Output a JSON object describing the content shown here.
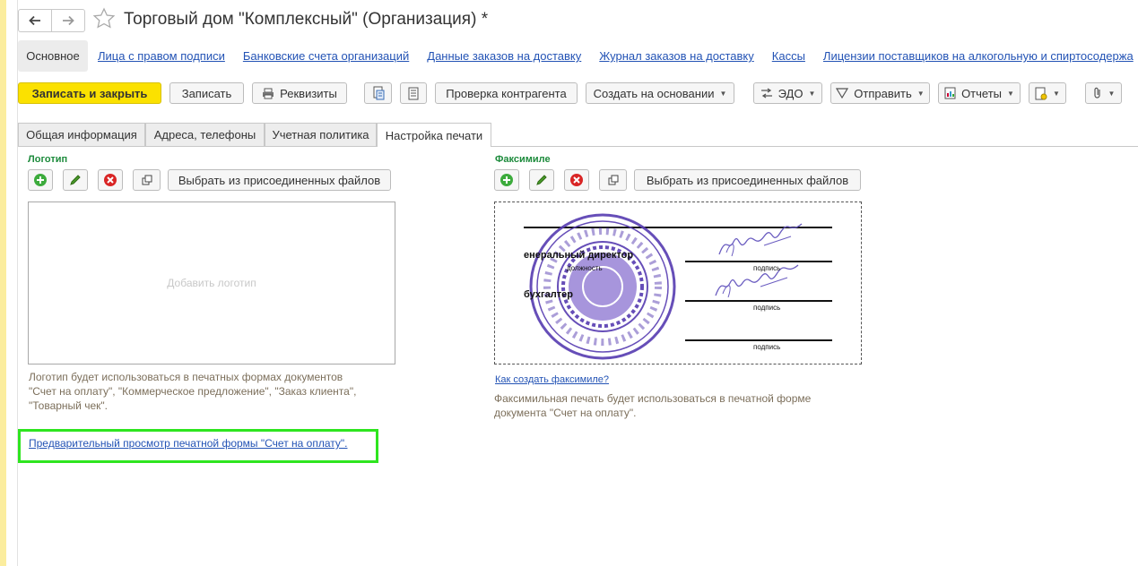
{
  "window": {
    "title": "Торговый дом \"Комплексный\" (Организация) *"
  },
  "sections": {
    "active": "Основное",
    "links": [
      "Лица с правом подписи",
      "Банковские счета организаций",
      "Данные заказов на доставку",
      "Журнал заказов на доставку",
      "Кассы",
      "Лицензии поставщиков на алкогольную и спиртосодержа"
    ]
  },
  "toolbar": {
    "save_close": "Записать и закрыть",
    "save": "Записать",
    "requisites": "Реквизиты",
    "check_counterparty": "Проверка контрагента",
    "create_based": "Создать на основании",
    "edo": "ЭДО",
    "send": "Отправить",
    "reports": "Отчеты"
  },
  "tabs": [
    "Общая информация",
    "Адреса, телефоны",
    "Учетная политика",
    "Настройка печати"
  ],
  "logo": {
    "title": "Логотип",
    "pick_label": "Выбрать из присоединенных файлов",
    "placeholder": "Добавить логотип",
    "note_lines": [
      "Логотип будет использоваться в печатных формах документов",
      "\"Счет на оплату\", \"Коммерческое предложение\", \"Заказ клиента\",",
      "\"Товарный чек\"."
    ]
  },
  "facsimile": {
    "title": "Факсимиле",
    "pick_label": "Выбрать  из присоединенных файлов",
    "how_link": "Как создать факсимиле?",
    "note_lines": [
      "Факсимильная печать будет использоваться в печатной форме",
      "документа \"Счет на оплату\"."
    ],
    "image": {
      "director": "енеральный директор",
      "position": "должность",
      "accountant": "бухгалтер",
      "signature": "подпись"
    }
  },
  "preview_link": "Предварительный просмотр печатной формы \"Счет на оплату\".",
  "colors": {
    "accent_yellow": "#fbe100",
    "group_green": "#1d8b3c",
    "link_blue": "#2353b5",
    "highlight_green": "#2ee51f",
    "stamp_purple": "#5a3fb3"
  }
}
